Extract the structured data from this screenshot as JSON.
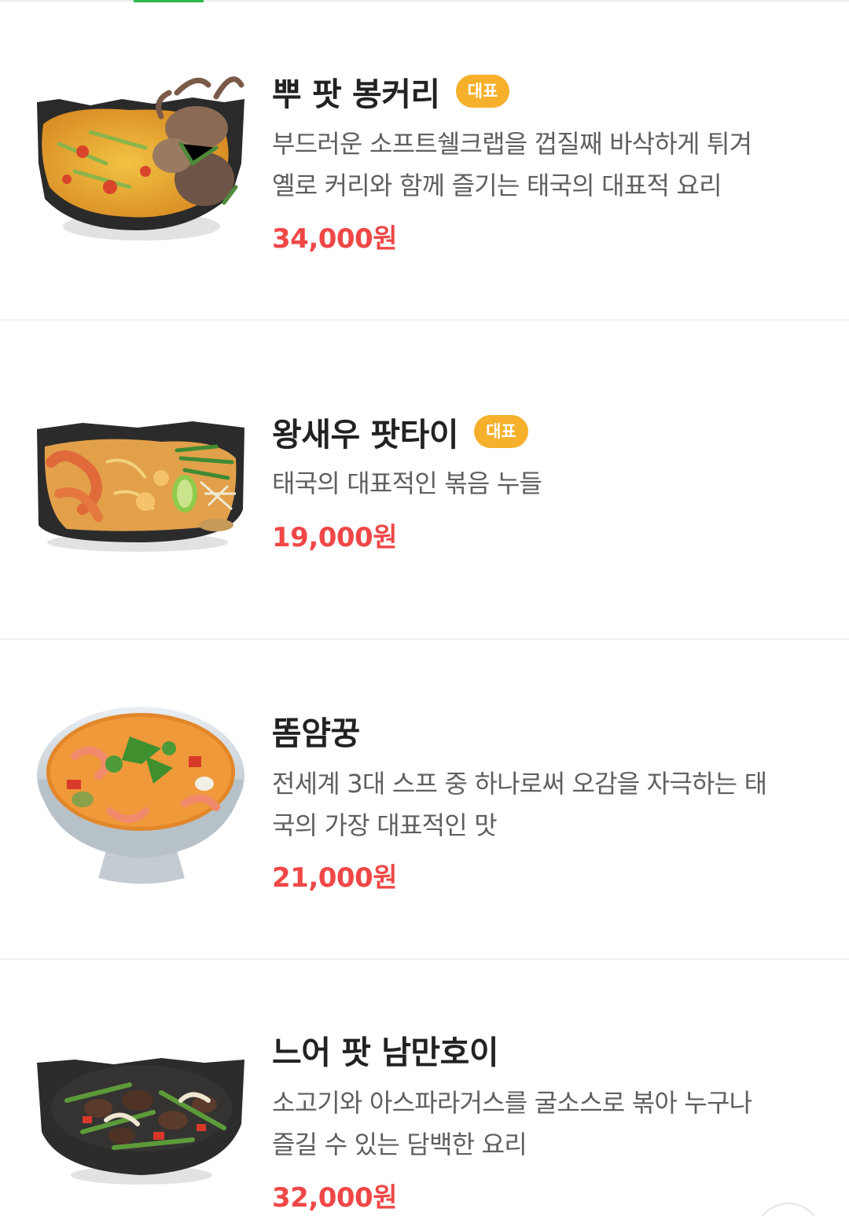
{
  "menu": {
    "items": [
      {
        "name": "뿌 팟 봉커리",
        "badge": "대표",
        "description_lines": [
          "부드러운 소프트쉘크랩을 껍질째 바삭하게 튀겨",
          "옐로 커리와 함께 즐기는 태국의 대표적 요리"
        ],
        "price": "34,000원",
        "image_icon": "crab-curry-dish-image"
      },
      {
        "name": "왕새우 팟타이",
        "badge": "대표",
        "description_lines": [
          "태국의 대표적인 볶음 누들"
        ],
        "price": "19,000원",
        "image_icon": "pad-thai-dish-image"
      },
      {
        "name": "똠얌꿍",
        "badge": "",
        "description_lines": [
          "전세계 3대 스프 중 하나로써 오감을 자극하는 태",
          "국의 가장 대표적인 맛"
        ],
        "price": "21,000원",
        "image_icon": "tom-yum-soup-image"
      },
      {
        "name": "느어 팟 남만호이",
        "badge": "",
        "description_lines": [
          "소고기와 아스파라거스를 굴소스로 볶아 누구나",
          "즐길 수 있는 담백한 요리"
        ],
        "price": "32,000원",
        "image_icon": "beef-stirfry-dish-image"
      }
    ]
  },
  "colors": {
    "badge": "#f6b02c",
    "price": "#ef4747",
    "tab_indicator": "#2db84a",
    "title": "#222222",
    "description": "#5f5f5f"
  },
  "scroll_button_icon": "scroll-to-top-icon"
}
